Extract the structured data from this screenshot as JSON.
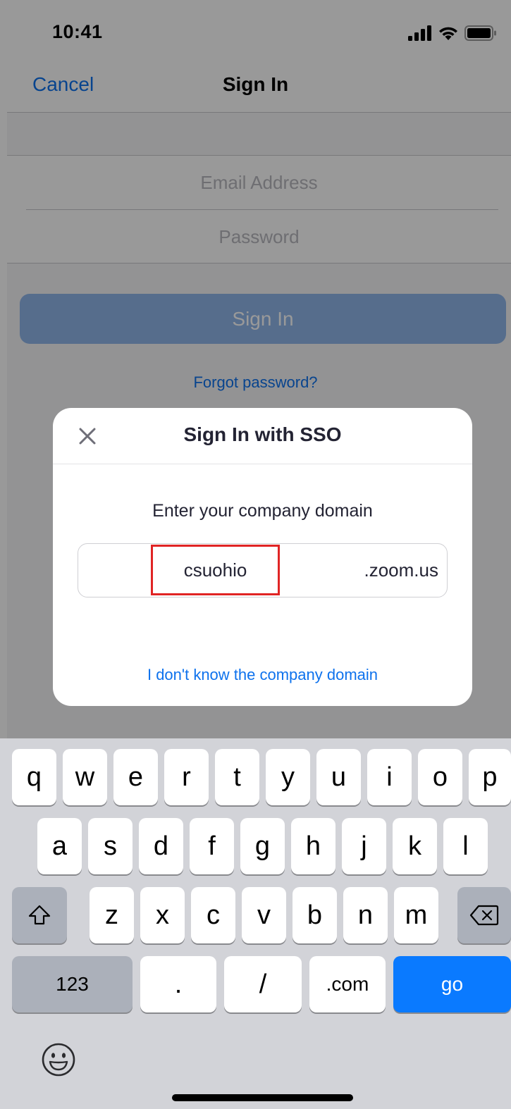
{
  "status_bar": {
    "time": "10:41",
    "icons": [
      "signal-icon",
      "wifi-icon",
      "battery-icon"
    ]
  },
  "nav": {
    "cancel_label": "Cancel",
    "title": "Sign In"
  },
  "form": {
    "email_placeholder": "Email Address",
    "password_placeholder": "Password",
    "sign_in_label": "Sign In",
    "forgot_label": "Forgot password?"
  },
  "sso_modal": {
    "title": "Sign In with SSO",
    "close_icon": "close-icon",
    "prompt": "Enter your company domain",
    "domain_value": "csuohio",
    "domain_suffix": ".zoom.us",
    "unknown_domain_link": "I don't know the company domain"
  },
  "keyboard": {
    "row1": [
      "q",
      "w",
      "e",
      "r",
      "t",
      "y",
      "u",
      "i",
      "o",
      "p"
    ],
    "row2": [
      "a",
      "s",
      "d",
      "f",
      "g",
      "h",
      "j",
      "k",
      "l"
    ],
    "row3": [
      "z",
      "x",
      "c",
      "v",
      "b",
      "n",
      "m"
    ],
    "numbers_label": "123",
    "dot_label": ".",
    "slash_label": "/",
    "dotcom_label": ".com",
    "go_label": "go",
    "shift_icon": "shift-icon",
    "delete_icon": "delete-icon",
    "emoji_icon": "emoji-icon"
  },
  "colors": {
    "accent": "#0e72ed",
    "go_key": "#0a7aff",
    "highlight_border": "#e02424"
  }
}
